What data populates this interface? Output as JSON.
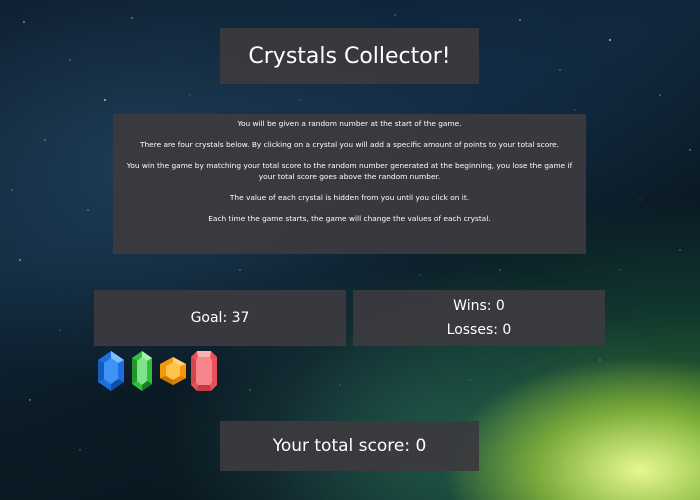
{
  "title": "Crystals Collector!",
  "instructions": [
    "You will be given a random number at the start of the game.",
    "There are four crystals below. By clicking on a crystal you will add a specific amount of points to your total score.",
    "You win the game by matching your total score to the random number generated at the beginning, you lose the game if your total score goes above the random number.",
    "The value of each crystal is hidden from you until you click on it.",
    "Each time the game starts, the game will change the values of each crystal."
  ],
  "goal_text": "Goal: 37",
  "wins_text": "Wins: 0",
  "losses_text": "Losses: 0",
  "total_score_text": "Your total score: 0",
  "crystals": [
    {
      "name": "blue-crystal-icon",
      "color": "#1e6fe0"
    },
    {
      "name": "green-crystal-icon",
      "color": "#2fbf3a"
    },
    {
      "name": "orange-crystal-icon",
      "color": "#f29a0c"
    },
    {
      "name": "red-crystal-icon",
      "color": "#e8505a"
    }
  ]
}
